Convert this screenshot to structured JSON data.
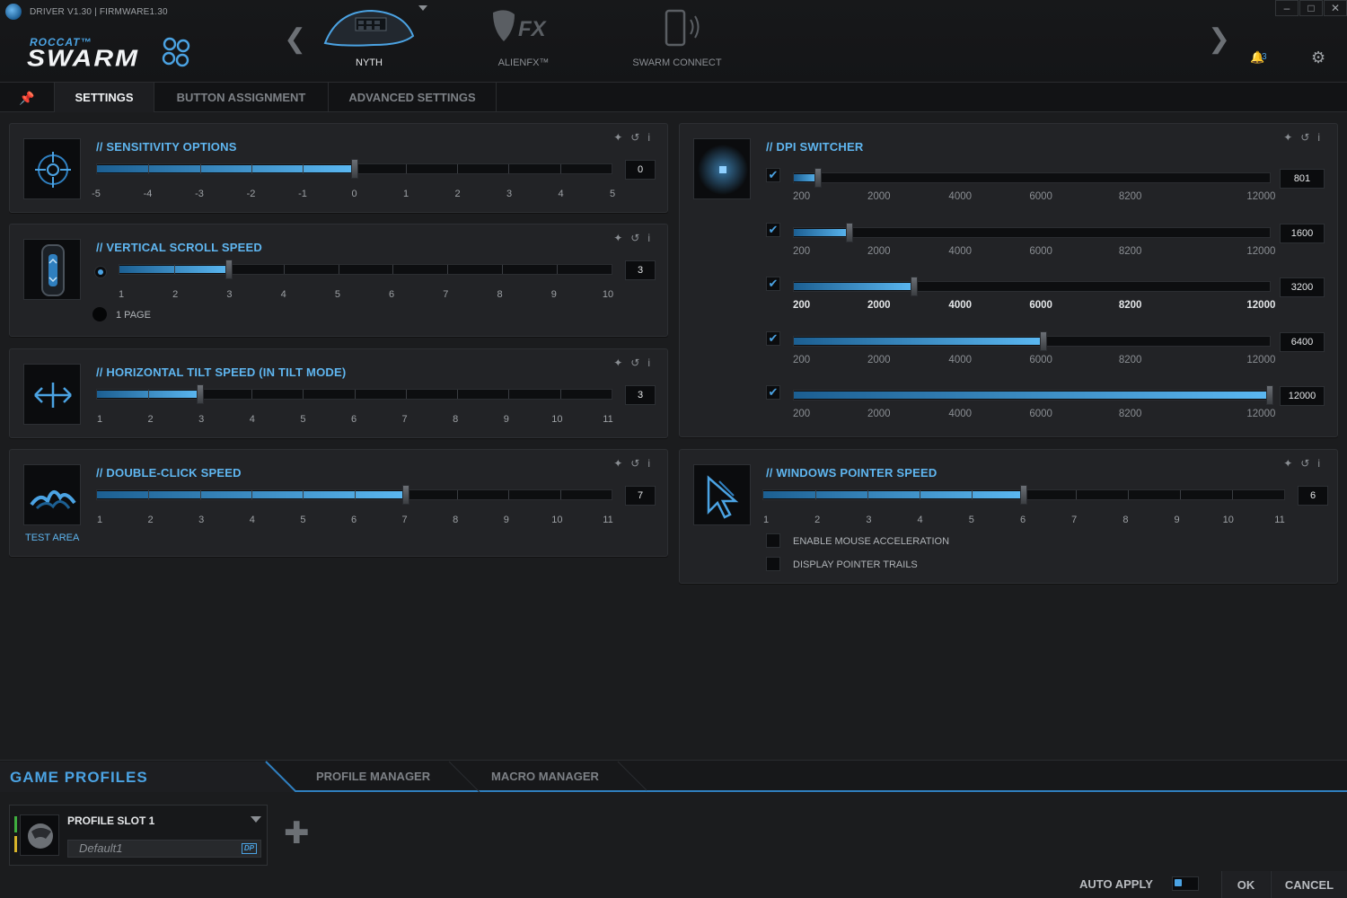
{
  "header": {
    "driver_info": "DRIVER V1.30 | FIRMWARE1.30",
    "logo_brand": "ROCCAT™",
    "logo_name": "SWARM",
    "devices": [
      {
        "label": "NYTH",
        "active": true
      },
      {
        "label": "ALIENFX™",
        "active": false
      },
      {
        "label": "SWARM CONNECT",
        "active": false
      }
    ],
    "notification_count": "3",
    "icons": [
      "bell-icon",
      "gear-icon",
      "minimize-icon",
      "maximize-icon",
      "close-icon"
    ]
  },
  "tabs": [
    {
      "label": "SETTINGS",
      "active": true
    },
    {
      "label": "BUTTON ASSIGNMENT",
      "active": false
    },
    {
      "label": "ADVANCED SETTINGS",
      "active": false
    }
  ],
  "sensitivity": {
    "title": "// SENSITIVITY OPTIONS",
    "value": "0",
    "scale": [
      "-5",
      "-4",
      "-3",
      "-2",
      "-1",
      "0",
      "1",
      "2",
      "3",
      "4",
      "5"
    ],
    "level": 0.5
  },
  "vertical_scroll": {
    "title": "// VERTICAL SCROLL SPEED",
    "value": "3",
    "scale": [
      "1",
      "2",
      "3",
      "4",
      "5",
      "6",
      "7",
      "8",
      "9",
      "10"
    ],
    "level": 0.222,
    "page_option": "1 PAGE"
  },
  "horizontal_tilt": {
    "title": "// HORIZONTAL TILT SPEED (IN TILT MODE)",
    "value": "3",
    "scale": [
      "1",
      "2",
      "3",
      "4",
      "5",
      "6",
      "7",
      "8",
      "9",
      "10",
      "11"
    ],
    "level": 0.2
  },
  "double_click": {
    "title": "// DOUBLE-CLICK SPEED",
    "value": "7",
    "scale": [
      "1",
      "2",
      "3",
      "4",
      "5",
      "6",
      "7",
      "8",
      "9",
      "10",
      "11"
    ],
    "level": 0.6,
    "test_area": "TEST AREA"
  },
  "dpi_switcher": {
    "title": "// DPI SWITCHER",
    "scale": [
      "200",
      "2000",
      "4000",
      "6000",
      "8200",
      "12000"
    ],
    "levels": [
      {
        "value": "801",
        "enabled": true,
        "level": 0.05,
        "active": false
      },
      {
        "value": "1600",
        "enabled": true,
        "level": 0.117,
        "active": false
      },
      {
        "value": "3200",
        "enabled": true,
        "level": 0.253,
        "active": true
      },
      {
        "value": "6400",
        "enabled": true,
        "level": 0.525,
        "active": false
      },
      {
        "value": "12000",
        "enabled": true,
        "level": 1.0,
        "active": false
      }
    ]
  },
  "pointer_speed": {
    "title": "// WINDOWS POINTER SPEED",
    "value": "6",
    "scale": [
      "1",
      "2",
      "3",
      "4",
      "5",
      "6",
      "7",
      "8",
      "9",
      "10",
      "11"
    ],
    "level": 0.5,
    "options": [
      {
        "label": "ENABLE MOUSE ACCELERATION",
        "checked": false
      },
      {
        "label": "DISPLAY POINTER TRAILS",
        "checked": false
      }
    ]
  },
  "bottom": {
    "title": "GAME PROFILES",
    "tabs": [
      "PROFILE MANAGER",
      "MACRO MANAGER"
    ],
    "profile_slot": "PROFILE SLOT 1",
    "profile_name": "Default1",
    "profile_tag": "DP",
    "auto_apply": "AUTO APPLY",
    "ok": "OK",
    "cancel": "CANCEL"
  },
  "colors": {
    "accent": "#4ba3e3",
    "background": "#1b1c1e",
    "panel": "#222326"
  }
}
